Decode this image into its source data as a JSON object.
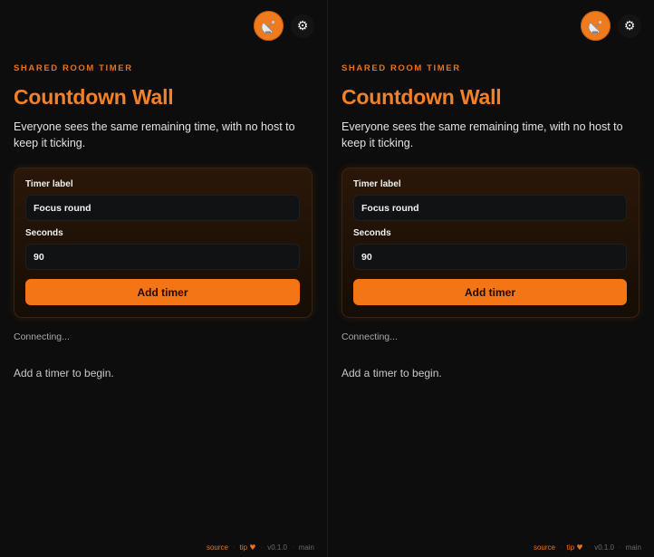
{
  "panes": [
    {
      "eyebrow": "SHARED ROOM TIMER",
      "title": "Countdown Wall",
      "description": "Everyone sees the same remaining time, with no host to keep it ticking.",
      "form": {
        "label_field": {
          "label": "Timer label",
          "value": "Focus round"
        },
        "seconds_field": {
          "label": "Seconds",
          "value": "90"
        },
        "submit_label": "Add timer"
      },
      "status": "Connecting...",
      "empty_message": "Add a timer to begin.",
      "footer": {
        "source": "source",
        "tip": "tip",
        "tip_icon": "♥",
        "version": "v0.1.0",
        "branch": "main"
      },
      "icons": {
        "avatar": "satellite-dish-icon",
        "settings": "⚙"
      }
    },
    {
      "eyebrow": "SHARED ROOM TIMER",
      "title": "Countdown Wall",
      "description": "Everyone sees the same remaining time, with no host to keep it ticking.",
      "form": {
        "label_field": {
          "label": "Timer label",
          "value": "Focus round"
        },
        "seconds_field": {
          "label": "Seconds",
          "value": "90"
        },
        "submit_label": "Add timer"
      },
      "status": "Connecting...",
      "empty_message": "Add a timer to begin.",
      "footer": {
        "source": "source",
        "tip": "tip",
        "tip_icon": "♥",
        "version": "v0.1.0",
        "branch": "main"
      },
      "icons": {
        "avatar": "satellite-dish-icon",
        "settings": "⚙"
      }
    }
  ],
  "colors": {
    "accent": "#f47516",
    "background": "#0d0d0d"
  }
}
